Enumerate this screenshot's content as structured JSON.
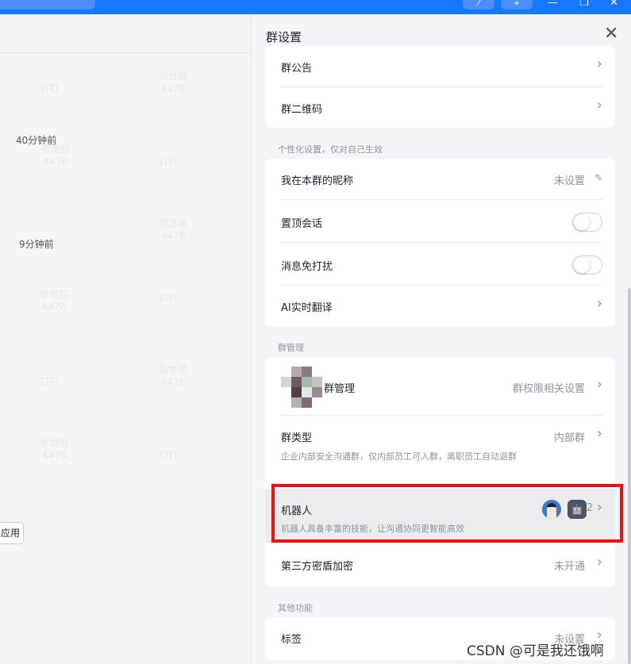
{
  "topbar": {
    "btn1": "⁄",
    "btn2": "+",
    "win_min": "—",
    "win_max": "❐",
    "win_close": "✕"
  },
  "chat": {
    "times": [
      "40分钟前",
      "9分钟前"
    ],
    "watermark_name": "张世丽",
    "watermark_id": "4476",
    "watermark_brand": "钉钉",
    "apps_button": "应用"
  },
  "panel": {
    "title": "群设置",
    "close_icon": "close-icon",
    "card_top": [
      {
        "label": "群公告"
      },
      {
        "label": "群二维码"
      }
    ],
    "personal_section": "个性化设置，仅对自己生效",
    "personal": {
      "nickname_label": "我在本群的昵称",
      "nickname_value": "未设置",
      "pin_label": "置顶会话",
      "pin_on": false,
      "mute_label": "消息免打扰",
      "mute_on": false,
      "translate_label": "AI实时翻译"
    },
    "manage_section": "群管理",
    "manage": {
      "admin_label": "群管理",
      "admin_value": "群权限相关设置",
      "type_label": "群类型",
      "type_value": "内部群",
      "type_desc": "企业内部安全沟通群，仅内部员工可入群，离职员工自动退群",
      "robot_label": "机器人",
      "robot_desc": "机器人具备丰富的技能，让沟通协同更智能高效",
      "robot_count": "2",
      "encrypt_label": "第三方密盾加密",
      "encrypt_value": "未开通"
    },
    "other_section": "其他功能",
    "other": {
      "tag_label": "标签",
      "tag_value": "未设置"
    }
  },
  "watermark": "CSDN @可是我还饿啊",
  "colors": {
    "accent": "#1677ff",
    "highlight": "#ee1111"
  }
}
